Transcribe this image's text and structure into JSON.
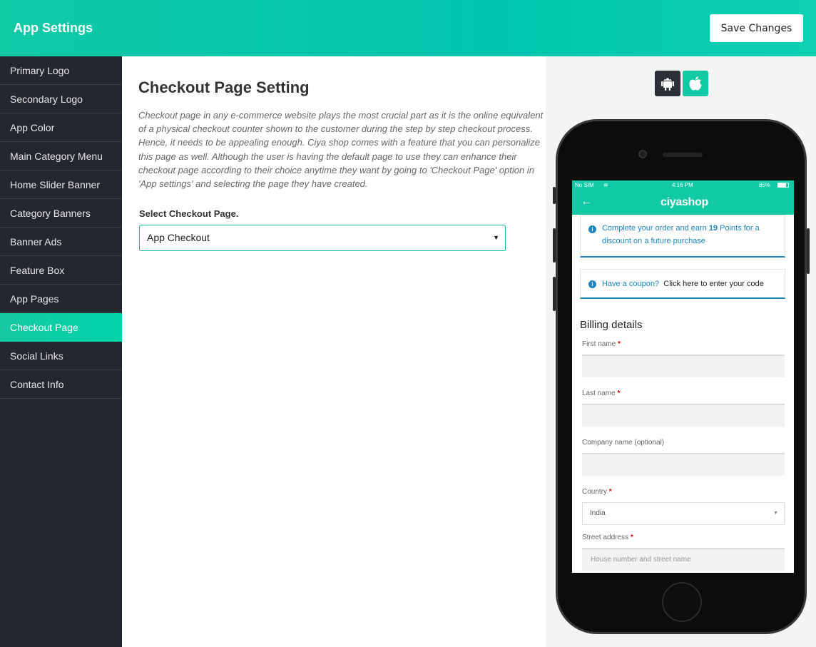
{
  "header": {
    "title": "App Settings",
    "save_label": "Save Changes"
  },
  "sidebar": {
    "items": [
      {
        "label": "Primary Logo"
      },
      {
        "label": "Secondary Logo"
      },
      {
        "label": "App Color"
      },
      {
        "label": "Main Category Menu"
      },
      {
        "label": "Home Slider Banner"
      },
      {
        "label": "Category Banners"
      },
      {
        "label": "Banner Ads"
      },
      {
        "label": "Feature Box"
      },
      {
        "label": "App Pages"
      },
      {
        "label": "Checkout Page"
      },
      {
        "label": "Social Links"
      },
      {
        "label": "Contact Info"
      }
    ],
    "active_index": 9
  },
  "main": {
    "title": "Checkout Page Setting",
    "description": "Checkout page in any e-commerce website plays the most crucial part as it is the online equivalent of a physical checkout counter shown to the customer during the step by step checkout process. Hence, it needs to be appealing enough. Ciya shop comes with a feature that you can personalize this page as well. Although the user is having the default page to use they can enhance their checkout page according to their choice anytime they want by going to 'Checkout Page' option in 'App settings' and selecting the page they have created.",
    "select_label": "Select Checkout Page.",
    "select_value": "App Checkout"
  },
  "preview": {
    "platforms": [
      {
        "name": "android-icon",
        "color": "#2a2f38"
      },
      {
        "name": "apple-icon",
        "color": "#12c9a6"
      }
    ],
    "phone": {
      "status": {
        "carrier": "No SIM",
        "time": "4:16 PM",
        "battery": "85%"
      },
      "brand": "ciyashop",
      "notice_points": {
        "prefix": "Complete your order and earn ",
        "points": "19",
        "suffix": " Points for a discount on a future purchase"
      },
      "notice_coupon": {
        "question": "Have a coupon?",
        "link": "Click here to enter your code"
      },
      "billing_title": "Billing details",
      "fields": {
        "first_name": "First name",
        "last_name": "Last name",
        "company": "Company name (optional)",
        "country": "Country",
        "country_value": "India",
        "street": "Street address",
        "street_placeholder": "House number and street name"
      },
      "required_mark": "*"
    }
  },
  "colors": {
    "accent": "#12c9a6",
    "sidebar_bg": "#23272f",
    "info_blue": "#1e85be"
  }
}
